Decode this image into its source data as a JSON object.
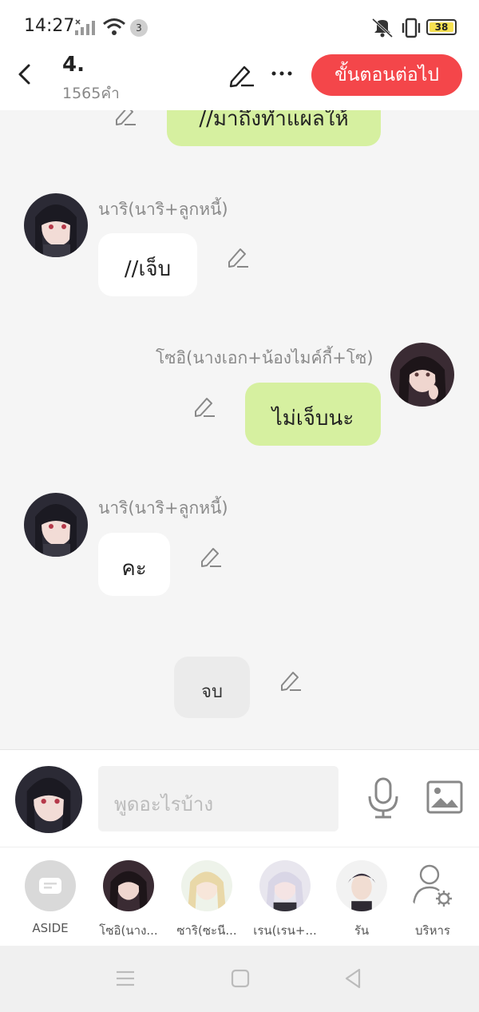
{
  "status_bar": {
    "time": "14:27",
    "notification_count": "3",
    "battery": "38"
  },
  "header": {
    "title": "4.",
    "word_count": "1565คำ",
    "next_label": "ขั้นตอนต่อไป"
  },
  "messages": [
    {
      "side": "right",
      "text": "//มาถึงทำแผลให้",
      "partial": true
    },
    {
      "side": "left",
      "speaker": "นาริ(นาริ+ลูกหนี้)",
      "text": "//เจ็บ"
    },
    {
      "side": "right",
      "speaker": "โซอิ(นางเอก+น้องไมค์กี้+โซ)",
      "text": "ไม่เจ็บนะ"
    },
    {
      "side": "left",
      "speaker": "นาริ(นาริ+ลูกหนี้)",
      "text": "คะ"
    },
    {
      "side": "center",
      "text": "จบ"
    }
  ],
  "input": {
    "placeholder": "พูดอะไรบ้าง"
  },
  "characters": [
    {
      "name": "ASIDE"
    },
    {
      "name": "โซอิ(นาง..."
    },
    {
      "name": "ซาริ(ซะนี..."
    },
    {
      "name": "เรน(เรน+..."
    },
    {
      "name": "รัน"
    },
    {
      "name": "บริหาร"
    }
  ],
  "colors": {
    "accent": "#f4464a",
    "own_bubble": "#d6f0a0",
    "other_bubble": "#ffffff"
  }
}
